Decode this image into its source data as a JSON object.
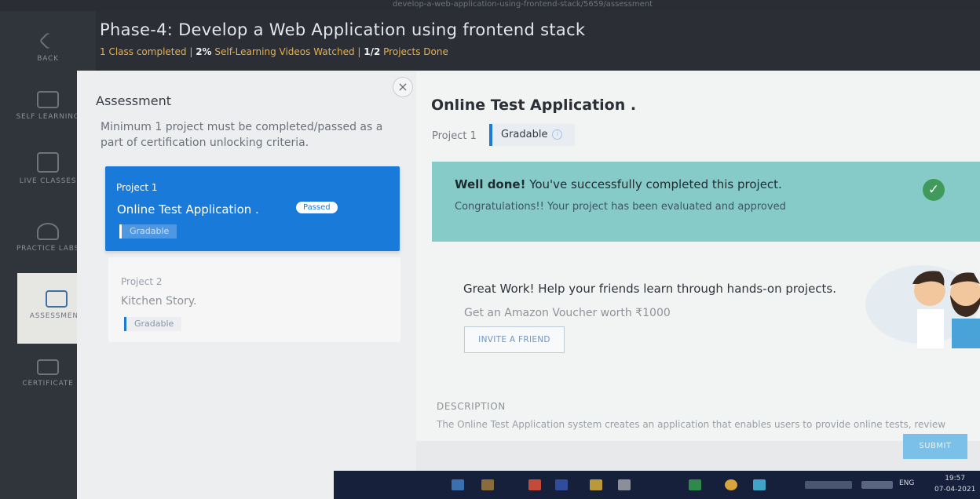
{
  "browser": {
    "url_fragment": "develop-a-web-application-using-frontend-stack/5659/assessment"
  },
  "header": {
    "title": "Phase-4: Develop a Web Application using frontend stack",
    "progress_prefix": "1 Class completed | ",
    "progress_videos": "2%",
    "progress_mid": " Self-Learning Videos Watched  | ",
    "progress_projects": "1/2",
    "progress_suffix": " Projects Done"
  },
  "sidebar": {
    "items": [
      {
        "label": "BACK"
      },
      {
        "label": "SELF LEARNING"
      },
      {
        "label": "LIVE CLASSES"
      },
      {
        "label": "PRACTICE LABS"
      },
      {
        "label": "ASSESSMENT"
      },
      {
        "label": "CERTIFICATE"
      }
    ]
  },
  "assessment": {
    "title": "Assessment",
    "description": "Minimum 1 project must be completed/passed as a part of certification unlocking criteria.",
    "close_glyph": "×",
    "projects": [
      {
        "number": "Project 1",
        "name": "Online Test Application .",
        "status": "Passed",
        "tag": "Gradable"
      },
      {
        "number": "Project 2",
        "name": "Kitchen Story.",
        "tag": "Gradable"
      }
    ]
  },
  "detail": {
    "title": "Online Test Application .",
    "tab_project": "Project 1",
    "tab_gradable": "Gradable",
    "info_glyph": "i",
    "done_bold": "Well done!",
    "done_text": " You've successfully completed this project.",
    "done_sub": "Congratulations!! Your project has been evaluated and approved",
    "check_glyph": "✓",
    "great_work": "Great Work! Help your friends learn through hands-on projects.",
    "voucher": "Get an Amazon Voucher worth ₹1000",
    "invite_label": "INVITE A FRIEND",
    "description_label": "DESCRIPTION",
    "description_text": "The Online Test Application system creates an application that enables users to provide online tests, review",
    "submit_label": "SUBMIT"
  },
  "taskbar": {
    "language": "ENG",
    "time": "19:57",
    "date": "07-04-2021"
  },
  "colors": {
    "accent": "#1a7ad9",
    "success": "#87cbc9",
    "header_bg": "#2b2e35",
    "warning_text": "#e7b04a"
  }
}
